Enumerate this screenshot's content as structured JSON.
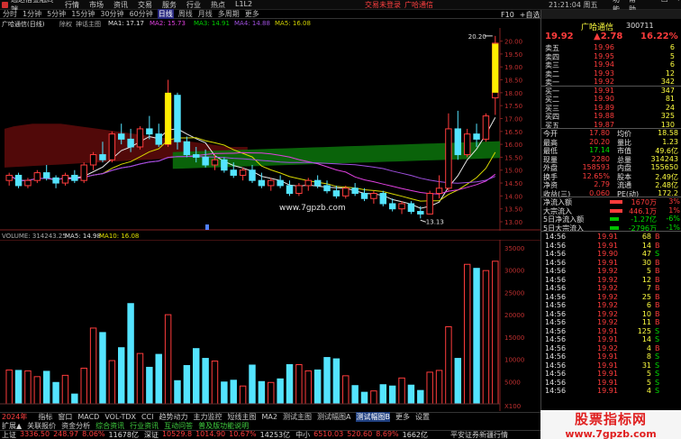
{
  "titlebar": {
    "app_name": "通达信金融终端",
    "menus": [
      "行情",
      "市场",
      "资讯",
      "交易",
      "服务",
      "行业",
      "热点",
      "L1L2"
    ],
    "trade_label": "交易未登录",
    "stock_label": "广哈通信",
    "time": "21:21:04 周五",
    "window_controls": [
      "功能",
      "帮助",
      "—",
      "□",
      "×"
    ]
  },
  "toolbar": {
    "periods": [
      "分时",
      "1分钟",
      "5分钟",
      "15分钟",
      "30分钟",
      "60分钟",
      "日线",
      "周线",
      "月线",
      "多周期",
      "更多"
    ],
    "active": "日线",
    "right_tools": [
      "F10",
      "+自选",
      "+自选"
    ]
  },
  "indicator": {
    "stock_title": "广哈通信(日线)",
    "mode": "除权",
    "main": "神话主图",
    "ma1": "MA1: 17.17",
    "ma2": "MA2: 15.73",
    "ma3": "MA3: 14.91",
    "ma4": "MA4: 14.88",
    "ma5": "MA5: 16.08"
  },
  "colors": {
    "up": "#ff3c3c",
    "down": "#54e4ff",
    "yellow": "#ffee00",
    "green_band": "#0d7a0d",
    "red_band": "#6a0d0d"
  },
  "price_scale": [
    "20.00",
    "19.50",
    "19.00",
    "18.50",
    "18.00",
    "17.50",
    "17.00",
    "16.50",
    "16.00",
    "15.50",
    "15.00",
    "14.50",
    "14.00",
    "13.50",
    "13.00"
  ],
  "annotations": {
    "high": "20.20",
    "low": "13.13",
    "website": "www.7gpzb.com"
  },
  "volume": {
    "label": "VOLUME: 314243.25",
    "ma5": "MA5: 14.98",
    "ma10": "MA10: 16.08",
    "scale": [
      "35000",
      "30000",
      "25000",
      "20000",
      "15000",
      "10000",
      "5000",
      "X100"
    ]
  },
  "right_panel": {
    "stock_name": "广哈通信",
    "code": "300711",
    "price": "19.92",
    "change": "▲2.78",
    "pct": "16.22%",
    "asks": [
      {
        "label": "卖五",
        "price": "19.96",
        "vol": "6"
      },
      {
        "label": "卖四",
        "price": "19.95",
        "vol": "5"
      },
      {
        "label": "卖三",
        "price": "19.94",
        "vol": "6"
      },
      {
        "label": "卖二",
        "price": "19.93",
        "vol": "12"
      },
      {
        "label": "卖一",
        "price": "19.92",
        "vol": "342"
      }
    ],
    "bids": [
      {
        "label": "买一",
        "price": "19.91",
        "vol": "347"
      },
      {
        "label": "买二",
        "price": "19.90",
        "vol": "81"
      },
      {
        "label": "买三",
        "price": "19.89",
        "vol": "24"
      },
      {
        "label": "买四",
        "price": "19.88",
        "vol": "325"
      },
      {
        "label": "买五",
        "price": "19.87",
        "vol": "130"
      }
    ],
    "stats": [
      {
        "k1": "今开",
        "v1": "17.80",
        "k2": "均价",
        "v2": "18.58"
      },
      {
        "k1": "最高",
        "v1": "20.20",
        "k2": "量比",
        "v2": "1.23"
      },
      {
        "k1": "最低",
        "v1": "17.14",
        "k2": "市值",
        "v2": "49.6亿"
      },
      {
        "k1": "现量",
        "v1": "2280",
        "k2": "总量",
        "v2": "314243"
      },
      {
        "k1": "外盘",
        "v1": "158593",
        "k2": "内盘",
        "v2": "155650"
      },
      {
        "k1": "换手",
        "v1": "12.65%",
        "k2": "股本",
        "v2": "2.49亿"
      },
      {
        "k1": "净资",
        "v1": "2.79",
        "k2": "流通",
        "v2": "2.48亿"
      },
      {
        "k1": "收益(三)",
        "v1": "0.060",
        "k2": "PE(动)",
        "v2": "172.2"
      }
    ],
    "flows": [
      {
        "label": "净流入额",
        "value": "1670万",
        "pct": "3%",
        "up": true
      },
      {
        "label": "大宗流入",
        "value": "446.1万",
        "pct": "1%",
        "up": true
      },
      {
        "label": "5日净流入额",
        "value": "-1.27亿",
        "pct": "-6%",
        "up": false
      },
      {
        "label": "5日大宗流入",
        "value": "-2796万",
        "pct": "-1%",
        "up": false
      }
    ],
    "ticks": [
      {
        "t": "14:56",
        "p": "19.91",
        "v": "68",
        "s": "B"
      },
      {
        "t": "14:56",
        "p": "19.91",
        "v": "14",
        "s": "B"
      },
      {
        "t": "14:56",
        "p": "19.90",
        "v": "47",
        "s": "S"
      },
      {
        "t": "14:56",
        "p": "19.91",
        "v": "30",
        "s": "B"
      },
      {
        "t": "14:56",
        "p": "19.92",
        "v": "5",
        "s": "B"
      },
      {
        "t": "14:56",
        "p": "19.92",
        "v": "12",
        "s": "B"
      },
      {
        "t": "14:56",
        "p": "19.92",
        "v": "7",
        "s": "B"
      },
      {
        "t": "14:56",
        "p": "19.92",
        "v": "25",
        "s": "B"
      },
      {
        "t": "14:56",
        "p": "19.92",
        "v": "6",
        "s": "B"
      },
      {
        "t": "14:56",
        "p": "19.92",
        "v": "10",
        "s": "B"
      },
      {
        "t": "14:56",
        "p": "19.92",
        "v": "11",
        "s": "B"
      },
      {
        "t": "14:56",
        "p": "19.91",
        "v": "125",
        "s": "S"
      },
      {
        "t": "14:56",
        "p": "19.91",
        "v": "14",
        "s": "S"
      },
      {
        "t": "14:56",
        "p": "19.92",
        "v": "4",
        "s": "B"
      },
      {
        "t": "14:56",
        "p": "19.91",
        "v": "8",
        "s": "S"
      },
      {
        "t": "14:56",
        "p": "19.91",
        "v": "31",
        "s": "S"
      },
      {
        "t": "14:56",
        "p": "19.91",
        "v": "5",
        "s": "S"
      },
      {
        "t": "14:56",
        "p": "19.91",
        "v": "5",
        "s": "S"
      },
      {
        "t": "14:56",
        "p": "19.91",
        "v": "4",
        "s": "S"
      }
    ]
  },
  "bottom": {
    "year_label": "2024年",
    "tabs": [
      "指标",
      "窗口",
      "MACD",
      "VOL-TDX",
      "CCI",
      "趋势动力",
      "主力监控",
      "短线主图",
      "MA2",
      "测试主图",
      "测试幅图A",
      "测试幅图B",
      "更多",
      "设置"
    ],
    "active_tab": "测试幅图B",
    "tabs2": [
      "扩展▲",
      "关联报价",
      "资金分析",
      "综合资讯",
      "行业资讯",
      "互动问答",
      "普及版功能说明"
    ]
  },
  "statusbar": {
    "items": [
      {
        "name": "上证",
        "v": "3336.50",
        "c": "248.97",
        "p": "8.06%",
        "amt": "11678亿"
      },
      {
        "name": "深证",
        "v": "10529.8",
        "c": "1014.90",
        "p": "10.67%",
        "amt": "14253亿"
      },
      {
        "name": "中小",
        "v": "6510.03",
        "c": "520.60",
        "p": "8.69%",
        "amt": "1662亿"
      }
    ],
    "right_text": "平安证券新疆行情"
  },
  "watermark": {
    "title": "股票指标网",
    "url": "www.7gpzb.com"
  },
  "chart_data": {
    "type": "candlestick",
    "price_range": [
      13.0,
      20.3
    ],
    "candles": [
      {
        "o": 14.6,
        "h": 14.9,
        "l": 14.4,
        "c": 14.8
      },
      {
        "o": 14.8,
        "h": 14.9,
        "l": 14.3,
        "c": 14.4
      },
      {
        "o": 14.4,
        "h": 14.7,
        "l": 14.3,
        "c": 14.6
      },
      {
        "o": 14.6,
        "h": 15.0,
        "l": 14.5,
        "c": 14.9
      },
      {
        "o": 14.9,
        "h": 15.2,
        "l": 14.6,
        "c": 14.7
      },
      {
        "o": 14.7,
        "h": 14.8,
        "l": 14.3,
        "c": 14.5
      },
      {
        "o": 14.5,
        "h": 14.9,
        "l": 14.4,
        "c": 14.8
      },
      {
        "o": 14.8,
        "h": 15.0,
        "l": 14.5,
        "c": 14.6
      },
      {
        "o": 14.6,
        "h": 15.3,
        "l": 14.5,
        "c": 15.2
      },
      {
        "o": 15.2,
        "h": 15.7,
        "l": 15.0,
        "c": 15.6
      },
      {
        "o": 15.6,
        "h": 16.1,
        "l": 15.3,
        "c": 15.4
      },
      {
        "o": 15.4,
        "h": 16.5,
        "l": 15.3,
        "c": 16.4
      },
      {
        "o": 16.4,
        "h": 16.8,
        "l": 16.0,
        "c": 16.2
      },
      {
        "o": 16.2,
        "h": 16.6,
        "l": 15.7,
        "c": 15.9
      },
      {
        "o": 15.9,
        "h": 16.7,
        "l": 15.8,
        "c": 16.6
      },
      {
        "o": 16.6,
        "h": 17.1,
        "l": 16.2,
        "c": 16.4
      },
      {
        "o": 16.4,
        "h": 16.8,
        "l": 15.9,
        "c": 16.0
      },
      {
        "o": 16.0,
        "h": 18.5,
        "l": 15.9,
        "c": 17.9
      },
      {
        "o": 17.9,
        "h": 18.0,
        "l": 15.8,
        "c": 16.1
      },
      {
        "o": 16.1,
        "h": 16.3,
        "l": 15.5,
        "c": 15.6
      },
      {
        "o": 15.6,
        "h": 15.9,
        "l": 15.3,
        "c": 15.5
      },
      {
        "o": 15.5,
        "h": 15.8,
        "l": 15.1,
        "c": 15.2
      },
      {
        "o": 15.2,
        "h": 15.6,
        "l": 15.0,
        "c": 15.4
      },
      {
        "o": 15.4,
        "h": 15.5,
        "l": 14.9,
        "c": 15.0
      },
      {
        "o": 15.0,
        "h": 15.3,
        "l": 14.7,
        "c": 14.8
      },
      {
        "o": 14.8,
        "h": 15.1,
        "l": 14.6,
        "c": 15.0
      },
      {
        "o": 15.0,
        "h": 15.2,
        "l": 14.5,
        "c": 14.6
      },
      {
        "o": 14.6,
        "h": 14.9,
        "l": 14.3,
        "c": 14.4
      },
      {
        "o": 14.4,
        "h": 14.7,
        "l": 14.2,
        "c": 14.6
      },
      {
        "o": 14.6,
        "h": 14.8,
        "l": 14.3,
        "c": 14.4
      },
      {
        "o": 14.4,
        "h": 14.6,
        "l": 14.0,
        "c": 14.1
      },
      {
        "o": 14.1,
        "h": 14.5,
        "l": 14.0,
        "c": 14.4
      },
      {
        "o": 14.4,
        "h": 14.7,
        "l": 14.2,
        "c": 14.6
      },
      {
        "o": 14.6,
        "h": 14.8,
        "l": 14.3,
        "c": 14.4
      },
      {
        "o": 14.4,
        "h": 14.6,
        "l": 14.1,
        "c": 14.2
      },
      {
        "o": 14.2,
        "h": 14.4,
        "l": 13.9,
        "c": 14.0
      },
      {
        "o": 14.0,
        "h": 14.4,
        "l": 13.9,
        "c": 14.3
      },
      {
        "o": 14.3,
        "h": 14.5,
        "l": 14.0,
        "c": 14.1
      },
      {
        "o": 14.1,
        "h": 14.3,
        "l": 13.8,
        "c": 13.9
      },
      {
        "o": 13.9,
        "h": 14.2,
        "l": 13.7,
        "c": 14.1
      },
      {
        "o": 14.1,
        "h": 14.2,
        "l": 13.6,
        "c": 13.7
      },
      {
        "o": 13.7,
        "h": 13.9,
        "l": 13.4,
        "c": 13.5
      },
      {
        "o": 13.5,
        "h": 13.8,
        "l": 13.3,
        "c": 13.7
      },
      {
        "o": 13.7,
        "h": 13.8,
        "l": 13.3,
        "c": 13.4
      },
      {
        "o": 13.4,
        "h": 13.6,
        "l": 13.13,
        "c": 13.3
      },
      {
        "o": 13.3,
        "h": 14.2,
        "l": 13.3,
        "c": 14.1
      },
      {
        "o": 14.1,
        "h": 14.8,
        "l": 13.9,
        "c": 14.3
      },
      {
        "o": 14.3,
        "h": 17.2,
        "l": 14.2,
        "c": 16.6
      },
      {
        "o": 16.6,
        "h": 17.3,
        "l": 15.4,
        "c": 15.6
      },
      {
        "o": 15.6,
        "h": 16.6,
        "l": 15.5,
        "c": 16.4
      },
      {
        "o": 16.4,
        "h": 16.8,
        "l": 15.9,
        "c": 16.2
      },
      {
        "o": 16.2,
        "h": 17.2,
        "l": 16.1,
        "c": 17.1
      },
      {
        "o": 17.8,
        "h": 20.2,
        "l": 17.14,
        "c": 19.92
      }
    ],
    "volumes": [
      7600,
      7500,
      7400,
      6100,
      7300,
      4800,
      6400,
      2200,
      8000,
      17000,
      16000,
      9700,
      12600,
      22500,
      11300,
      8200,
      11100,
      20000,
      5200,
      8600,
      12400,
      10200,
      9600,
      4900,
      5300,
      4000,
      8700,
      5000,
      4800,
      5600,
      8800,
      8800,
      7400,
      7600,
      10400,
      10100,
      6300,
      4100,
      2600,
      2900,
      4300,
      4000,
      5800,
      4200,
      3000,
      7100,
      7500,
      17300,
      10200,
      31300,
      30400,
      29900,
      32000
    ]
  }
}
